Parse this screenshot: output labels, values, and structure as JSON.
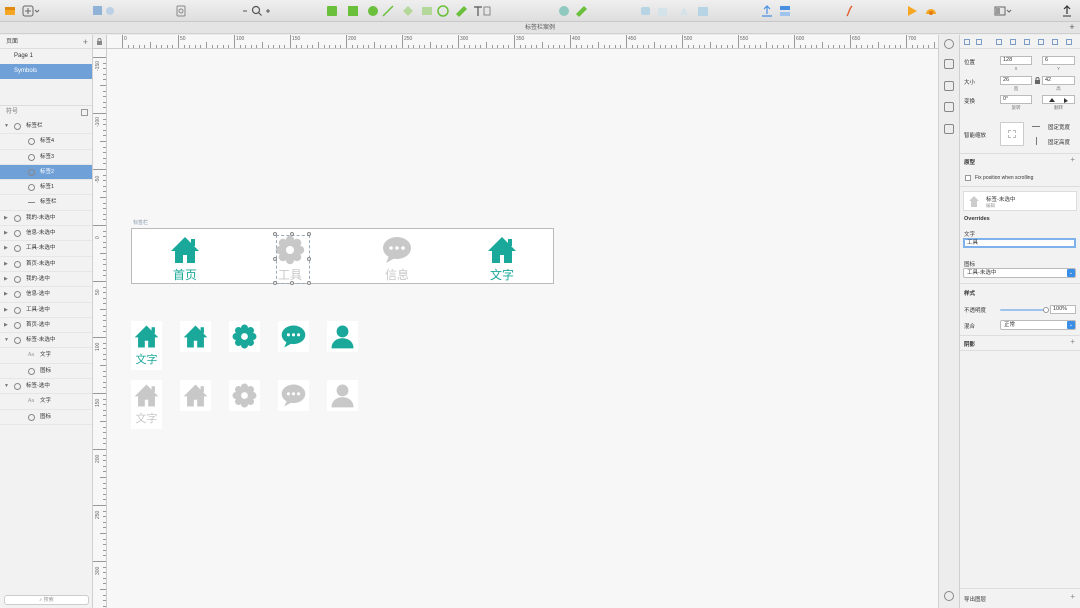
{
  "window": {
    "document_title": "标签栏案例"
  },
  "colors": {
    "accent": "#1aa89a",
    "inactive": "#c8c8c8",
    "selection": "#6fa0d8"
  },
  "pages_panel": {
    "header": "页面",
    "pages": [
      {
        "label": "Page 1"
      },
      {
        "label": "Symbols"
      }
    ]
  },
  "layers_panel": {
    "header": "符号",
    "search_placeholder": "搜索",
    "layers": [
      {
        "label": "标签栏",
        "indent": 0,
        "expanded": true,
        "type": "symbol"
      },
      {
        "label": "标签4",
        "indent": 1,
        "type": "symbol"
      },
      {
        "label": "标签3",
        "indent": 1,
        "type": "symbol"
      },
      {
        "label": "标签2",
        "indent": 1,
        "type": "symbol",
        "selected": true
      },
      {
        "label": "标签1",
        "indent": 1,
        "type": "symbol"
      },
      {
        "label": "标签栏",
        "indent": 1,
        "type": "line"
      },
      {
        "label": "我的-未选中",
        "indent": 0,
        "expanded": false,
        "type": "symbol"
      },
      {
        "label": "信息-未选中",
        "indent": 0,
        "expanded": false,
        "type": "symbol"
      },
      {
        "label": "工具-未选中",
        "indent": 0,
        "expanded": false,
        "type": "symbol"
      },
      {
        "label": "首页-未选中",
        "indent": 0,
        "expanded": false,
        "type": "symbol"
      },
      {
        "label": "我的-选中",
        "indent": 0,
        "expanded": false,
        "type": "symbol"
      },
      {
        "label": "信息-选中",
        "indent": 0,
        "expanded": false,
        "type": "symbol"
      },
      {
        "label": "工具-选中",
        "indent": 0,
        "expanded": false,
        "type": "symbol"
      },
      {
        "label": "首页-选中",
        "indent": 0,
        "expanded": false,
        "type": "symbol"
      },
      {
        "label": "标签-未选中",
        "indent": 0,
        "expanded": true,
        "type": "symbol"
      },
      {
        "label": "文字",
        "indent": 1,
        "type": "text"
      },
      {
        "label": "图标",
        "indent": 1,
        "type": "symbol"
      },
      {
        "label": "标签-选中",
        "indent": 0,
        "expanded": true,
        "type": "symbol"
      },
      {
        "label": "文字",
        "indent": 1,
        "type": "text"
      },
      {
        "label": "图标",
        "indent": 1,
        "type": "symbol"
      }
    ]
  },
  "ruler": {
    "top_labels": [
      "0",
      "50",
      "100",
      "150",
      "200",
      "250",
      "300",
      "350",
      "400",
      "450",
      "500",
      "550",
      "600",
      "650",
      "700"
    ],
    "left_labels": [
      "-150",
      "-100",
      "-50",
      "0",
      "50",
      "100",
      "150",
      "200",
      "250",
      "300"
    ]
  },
  "canvas": {
    "artboard_label": "标签栏",
    "tabbar": {
      "tabs": [
        {
          "label": "首页",
          "icon": "home-icon",
          "active": true
        },
        {
          "label": "工具",
          "icon": "gear-icon",
          "active": false
        },
        {
          "label": "信息",
          "icon": "chat-icon",
          "active": false
        },
        {
          "label": "文字",
          "icon": "home-icon",
          "active": true
        }
      ]
    },
    "selected_symbols": {
      "text_tile_caption": "文字",
      "icons": [
        "home-icon",
        "gear-icon",
        "chat-icon",
        "user-icon"
      ]
    },
    "unselected_symbols": {
      "text_tile_caption": "文字",
      "icons": [
        "home-icon",
        "gear-icon",
        "chat-icon",
        "user-icon"
      ]
    }
  },
  "inspector": {
    "position_label": "位置",
    "position_x": "128",
    "position_y": "6",
    "x_sub": "X",
    "y_sub": "Y",
    "size_label": "大小",
    "size_w": "26",
    "size_h": "42",
    "w_sub": "宽",
    "h_sub": "高",
    "transform_label": "变换",
    "rotation": "0°",
    "rotate_sub": "旋转",
    "flip_sub": "翻转",
    "smart_resize_label": "智能缩放",
    "fix_width": "固定宽度",
    "fix_height": "固定高度",
    "prototype_label": "原型",
    "fix_position": "Fix position when scrolling",
    "symbol_name": "标签-未选中",
    "symbol_sub": "编辑",
    "overrides_label": "Overrides",
    "text_label": "文字",
    "text_value": "工具",
    "icon_label": "图标",
    "icon_value": "工具-未选中",
    "style_label": "样式",
    "opacity_label": "不透明度",
    "opacity_value": "100%",
    "opacity_fraction": 1.0,
    "blend_label": "混合",
    "blend_value": "正常",
    "shadow_label": "阴影",
    "export_label": "导出图层"
  }
}
